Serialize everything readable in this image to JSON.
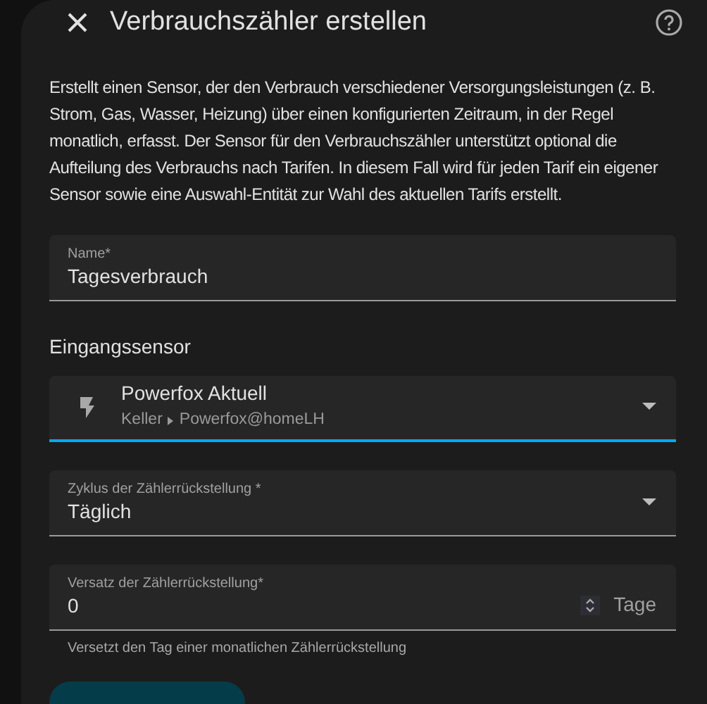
{
  "dialog": {
    "title": "Verbrauchszähler erstellen",
    "description": "Erstellt einen Sensor, der den Verbrauch verschiedener Versorgungsleistungen (z. B. Strom, Gas, Wasser, Heizung) über einen konfigurierten Zeitraum, in der Regel monatlich, erfasst. Der Sensor für den Verbrauchszähler unterstützt optional die Aufteilung des Verbrauchs nach Tarifen. In diesem Fall wird für jeden Tarif ein eigener Sensor sowie eine Auswahl-Entität zur Wahl des aktuellen Tarifs erstellt."
  },
  "fields": [
    {
      "kind": "text",
      "label": "Name*",
      "value": "Tagesverbrauch",
      "focused": false
    },
    {
      "kind": "heading",
      "label": "Eingangssensor"
    },
    {
      "kind": "entity",
      "value": "Powerfox Aktuell",
      "area": "Keller",
      "device": "Powerfox@homeLH",
      "focused": true
    },
    {
      "kind": "select",
      "label": "Zyklus der Zählerrückstellung *",
      "value": "Täglich",
      "focused": false
    },
    {
      "kind": "number",
      "label": "Versatz der Zählerrückstellung*",
      "value": "0",
      "unit": "Tage",
      "helper": "Versetzt den Tag einer monatlichen Zählerrückstellung",
      "focused": false
    },
    {
      "kind": "pill"
    }
  ]
}
